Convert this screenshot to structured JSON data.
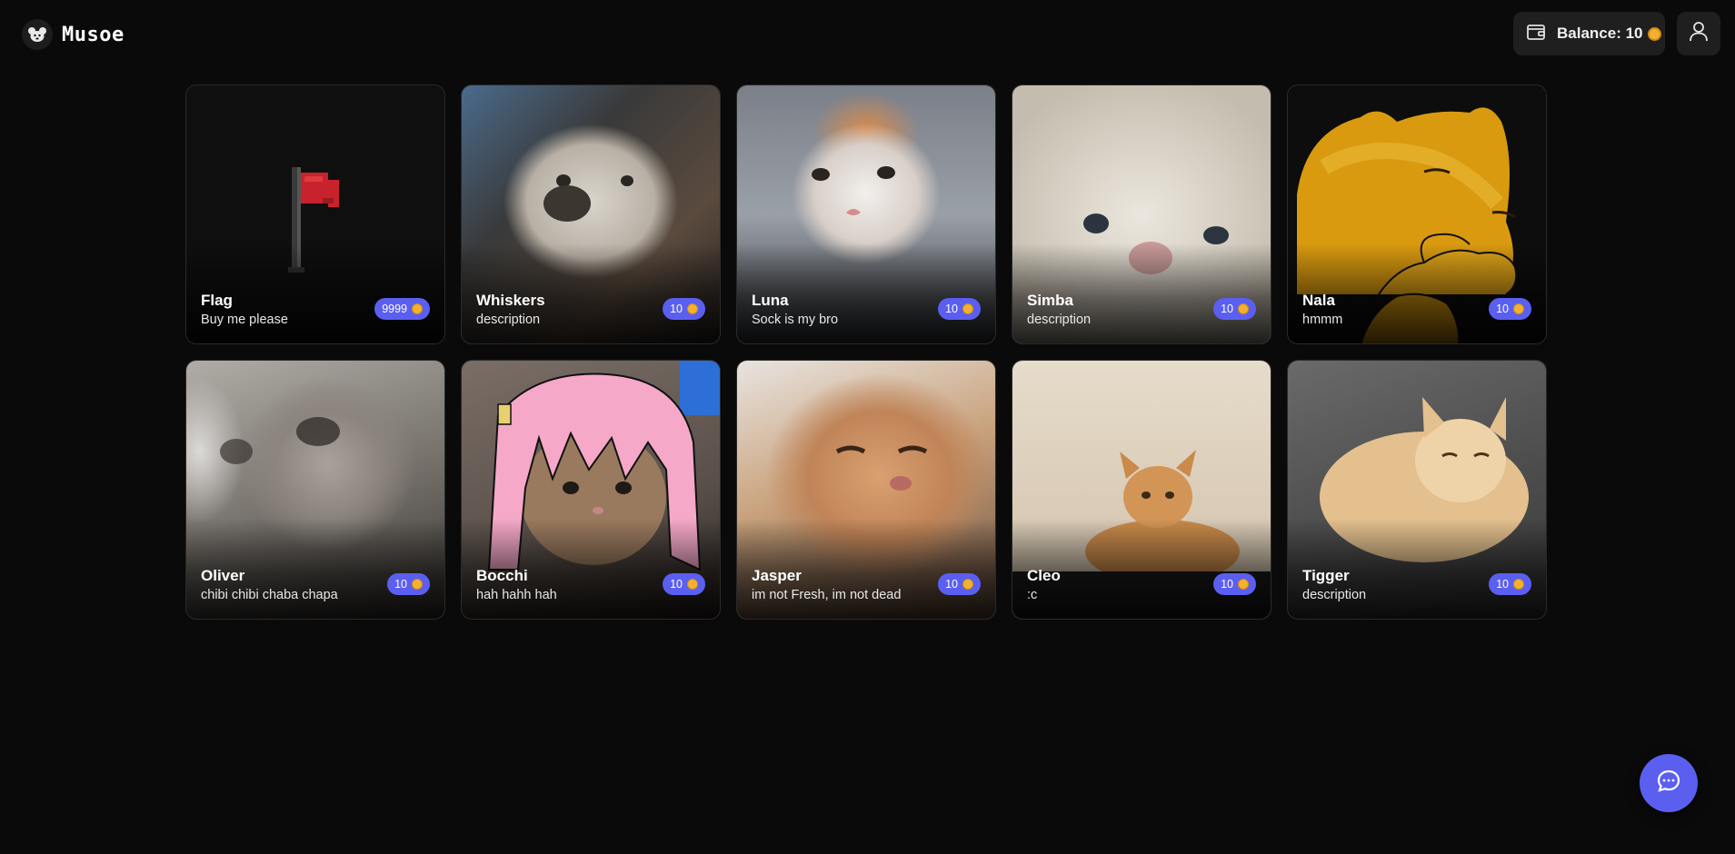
{
  "app": {
    "name": "Musoe",
    "logo_icon": "mouse-face-icon"
  },
  "header": {
    "balance_label": "Balance: 10",
    "balance_icon": "wallet-icon",
    "coin_icon": "coin-icon",
    "user_icon": "user-icon"
  },
  "products": [
    {
      "name": "Flag",
      "description": "Buy me please",
      "price": "9999",
      "art": "pixel-red-flag",
      "bg": "#0f0f0f"
    },
    {
      "name": "Whiskers",
      "description": "description",
      "price": "10",
      "art": "white-dog-photo",
      "bg": "#6b6159"
    },
    {
      "name": "Luna",
      "description": "Sock is my bro",
      "price": "10",
      "art": "orange-white-cat-photo",
      "bg": "#8a8d93"
    },
    {
      "name": "Simba",
      "description": "description",
      "price": "10",
      "art": "fluffy-white-cat-photo",
      "bg": "#cfc8bd"
    },
    {
      "name": "Nala",
      "description": "hmmm",
      "price": "10",
      "art": "shiba-meme-drawing",
      "bg": "#0d0d0d"
    },
    {
      "name": "Oliver",
      "description": "chibi chibi chaba chapa",
      "price": "10",
      "art": "blurry-gray-cat-photo",
      "bg": "#8f8c88"
    },
    {
      "name": "Bocchi",
      "description": "hah hahh hah",
      "price": "10",
      "art": "cat-with-pink-wig",
      "bg": "#6d625b"
    },
    {
      "name": "Jasper",
      "description": "im not Fresh, im not dead",
      "price": "10",
      "art": "orange-cat-closeup-photo",
      "bg": "#b9865c"
    },
    {
      "name": "Cleo",
      "description": ":c",
      "price": "10",
      "art": "orange-cat-sitting-photo",
      "bg": "#d9cbb6"
    },
    {
      "name": "Tigger",
      "description": "description",
      "price": "10",
      "art": "cream-cat-loaf-photo",
      "bg": "#5b5b5b"
    }
  ],
  "chat_button": {
    "icon": "chat-bubble-icon"
  },
  "colors": {
    "page_bg": "#0a0a0a",
    "card_border": "#2a2a2a",
    "accent": "#5b5ff0",
    "coin": "#f2b230",
    "header_button_bg": "#1f1f1f"
  }
}
